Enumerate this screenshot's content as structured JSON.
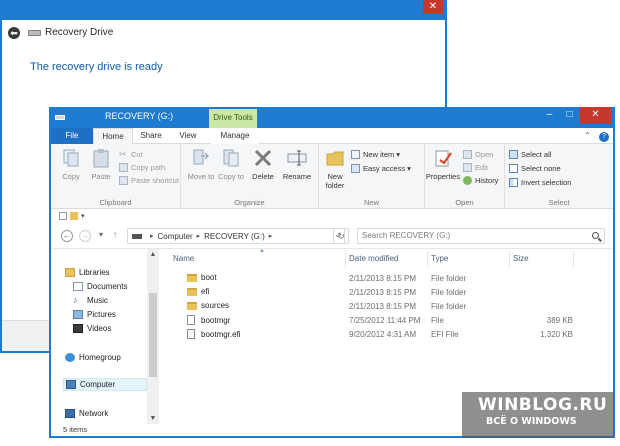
{
  "wizard": {
    "title": "Recovery Drive",
    "heading": "The recovery drive is ready",
    "close_glyph": "✕",
    "back_glyph": "⬅"
  },
  "explorer": {
    "title": "RECOVERY (G:)",
    "context_tab": "Drive Tools",
    "window_buttons": {
      "minimize": "–",
      "maximize": "□",
      "close": "✕"
    },
    "tabs": [
      "File",
      "Home",
      "Share",
      "View",
      "Manage"
    ],
    "ribbon": {
      "clipboard": {
        "label": "Clipboard",
        "copy": "Copy",
        "paste": "Paste",
        "cut": "Cut",
        "copy_path": "Copy path",
        "paste_shortcut": "Paste shortcut"
      },
      "organize": {
        "label": "Organize",
        "move_to": "Move to",
        "copy_to": "Copy to",
        "delete": "Delete",
        "rename": "Rename"
      },
      "new": {
        "label": "New",
        "new_folder": "New folder",
        "new_item": "New item",
        "easy_access": "Easy access"
      },
      "open": {
        "label": "Open",
        "properties": "Properties",
        "open": "Open",
        "edit": "Edit",
        "history": "History"
      },
      "select": {
        "label": "Select",
        "select_all": "Select all",
        "select_none": "Select none",
        "invert_selection": "Invert selection"
      }
    },
    "address": {
      "crumbs": [
        "Computer",
        "RECOVERY (G:)"
      ],
      "search_placeholder": "Search RECOVERY (G:)"
    },
    "nav_pane": [
      {
        "label": "Libraries",
        "icon": "libraries-icon"
      },
      {
        "label": "Documents",
        "icon": "documents-icon"
      },
      {
        "label": "Music",
        "icon": "music-icon"
      },
      {
        "label": "Pictures",
        "icon": "pictures-icon"
      },
      {
        "label": "Videos",
        "icon": "videos-icon"
      },
      {
        "label": "Homegroup",
        "icon": "homegroup-icon"
      },
      {
        "label": "Computer",
        "icon": "computer-icon"
      },
      {
        "label": "Network",
        "icon": "network-icon"
      }
    ],
    "columns": [
      "Name",
      "Date modified",
      "Type",
      "Size"
    ],
    "files": [
      {
        "name": "boot",
        "date": "2/11/2013 8:15 PM",
        "type": "File folder",
        "size": "",
        "icon": "folder-icon"
      },
      {
        "name": "efi",
        "date": "2/11/2013 8:15 PM",
        "type": "File folder",
        "size": "",
        "icon": "folder-icon"
      },
      {
        "name": "sources",
        "date": "2/11/2013 8:15 PM",
        "type": "File folder",
        "size": "",
        "icon": "folder-icon"
      },
      {
        "name": "bootmgr",
        "date": "7/25/2012 11:44 PM",
        "type": "File",
        "size": "389 KB",
        "icon": "file-icon"
      },
      {
        "name": "bootmgr.efi",
        "date": "9/20/2012 4:31 AM",
        "type": "EFI File",
        "size": "1,320 KB",
        "icon": "efi-file-icon"
      }
    ],
    "status": "5 items"
  },
  "watermark": {
    "line1": "WINBLOG.RU",
    "line2": "ВСЁ О WINDOWS"
  },
  "colors": {
    "window_frame": "#1e7bd0",
    "close_red": "#c7382c",
    "context_tab_green": "#cde8a6",
    "wizard_heading": "#0e5da8",
    "folder_yellow": "#e8c25a"
  }
}
